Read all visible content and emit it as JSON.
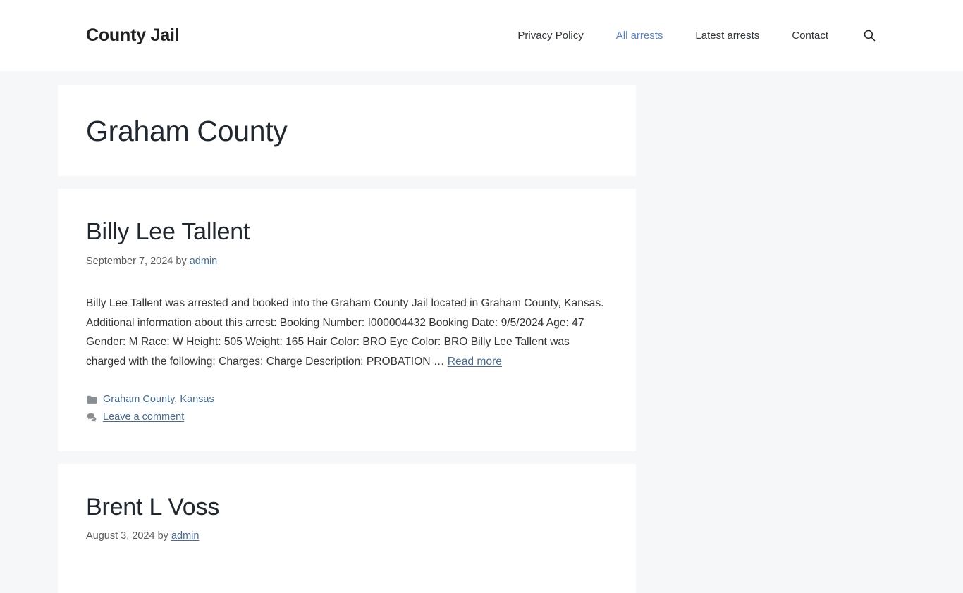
{
  "header": {
    "site_title": "County Jail",
    "nav": [
      {
        "label": "Privacy Policy",
        "active": false
      },
      {
        "label": "All arrests",
        "active": true
      },
      {
        "label": "Latest arrests",
        "active": false
      },
      {
        "label": "Contact",
        "active": false
      }
    ],
    "search_icon": "search-icon"
  },
  "archive": {
    "title": "Graham County"
  },
  "posts": [
    {
      "title": "Billy Lee Tallent",
      "meta_date": "September 7, 2024",
      "meta_by": "by",
      "meta_author": "admin",
      "excerpt": "Billy Lee Tallent was arrested and booked into the Graham County Jail located in Graham County, Kansas. Additional information about this arrest: Booking Number: I000004432 Booking Date: 9/5/2024 Age: 47 Gender: M Race: W Height: 505 Weight: 165 Hair Color: BRO Eye Color: BRO Billy Lee Tallent was charged with the following: Charges: Charge Description: PROBATION … ",
      "read_more": "Read more",
      "categories": [
        "Graham County",
        "Kansas"
      ],
      "category_separator": ", ",
      "comment_link": "Leave a comment"
    },
    {
      "title": "Brent L Voss",
      "meta_date": "August 3, 2024",
      "meta_by": "by",
      "meta_author": "admin"
    }
  ],
  "colors": {
    "page_background": "#f5f7f9",
    "card_background": "#ffffff",
    "link": "#4a6b8a",
    "nav_active": "#5b86b9",
    "heading": "#20272e",
    "meta_text": "#5a5a5a",
    "icon_gray": "#8a8f94"
  }
}
